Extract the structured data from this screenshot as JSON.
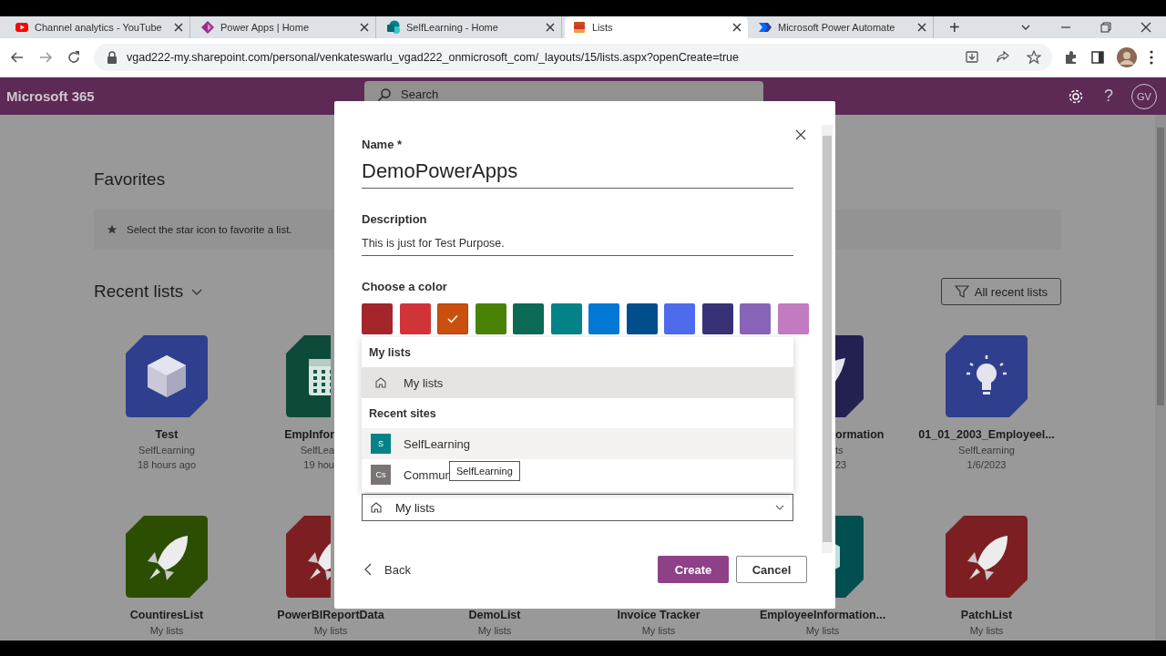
{
  "browser": {
    "tabs": [
      {
        "title": "Channel analytics - YouTube",
        "selected": false
      },
      {
        "title": "Power Apps | Home",
        "selected": false
      },
      {
        "title": "SelfLearning - Home",
        "selected": false
      },
      {
        "title": "Lists",
        "selected": true
      },
      {
        "title": "Microsoft Power Automate",
        "selected": false
      }
    ],
    "new_tab": "+",
    "address": "vgad222-my.sharepoint.com/personal/venkateswarlu_vgad222_onmicrosoft_com/_layouts/15/lists.aspx?openCreate=true"
  },
  "suite_bar": {
    "app_name": "Microsoft 365",
    "search": {
      "placeholder": "Search"
    },
    "help": "?",
    "avatar": "GV"
  },
  "page": {
    "favorites": {
      "title": "Favorites",
      "hint": "Select the star icon to favorite a list."
    },
    "recent": {
      "title": "Recent lists",
      "filter_button": "All recent lists"
    },
    "lists": [
      {
        "kind": "full",
        "title": "Test",
        "lines": [
          "SelfLearning",
          "18 hours ago"
        ],
        "color": "#2f3f8e"
      },
      {
        "kind": "partial-left",
        "title": "EmpInfor",
        "lines": [
          "SelfLea",
          "19 hou"
        ],
        "color": "#0d4a3a"
      },
      {
        "kind": "partial-right",
        "title": "ormation",
        "lines": [
          "ts",
          "23"
        ],
        "color": "#232052"
      },
      {
        "kind": "full",
        "title": "01_01_2003_Employeel...",
        "lines": [
          "SelfLearning",
          "1/6/2023"
        ],
        "color": "#2f3f8e"
      },
      {
        "kind": "full",
        "title": "CountiresList",
        "lines": [
          "My lists"
        ],
        "color": "#2c4e03"
      },
      {
        "kind": "icon-left",
        "title": "PowerBIReportData",
        "lines": [
          "My lists"
        ],
        "color": "#7d1f22"
      },
      {
        "kind": "title-only",
        "title": "DemoList",
        "lines": [
          "My lists"
        ]
      },
      {
        "kind": "title-only",
        "title": "Invoice Tracker",
        "lines": [
          "My lists"
        ]
      },
      {
        "kind": "icon-right",
        "title": "EmployeeInformation...",
        "lines": [
          "My lists"
        ],
        "color": "#024f51"
      },
      {
        "kind": "full",
        "title": "PatchList",
        "lines": [
          "My lists"
        ],
        "color": "#7d1f22"
      }
    ]
  },
  "dialog": {
    "name": {
      "label": "Name *",
      "value": "DemoPowerApps"
    },
    "description": {
      "label": "Description",
      "value": "This is just for Test Purpose."
    },
    "color_label": "Choose a color",
    "colors": [
      {
        "color": "#a4262c",
        "selected": false
      },
      {
        "color": "#d13438",
        "selected": false
      },
      {
        "color": "#ca5010",
        "selected": true
      },
      {
        "color": "#498205",
        "selected": false
      },
      {
        "color": "#0b6a53",
        "selected": false
      },
      {
        "color": "#038387",
        "selected": false
      },
      {
        "color": "#0078d4",
        "selected": false
      },
      {
        "color": "#004e8c",
        "selected": false
      },
      {
        "color": "#4f6bed",
        "selected": false
      },
      {
        "color": "#373277",
        "selected": false
      },
      {
        "color": "#8764b8",
        "selected": false
      },
      {
        "color": "#c27ac0",
        "selected": false
      }
    ],
    "location_menu": {
      "groups": [
        {
          "header": "My lists",
          "items": [
            {
              "kind": "home",
              "label": "My lists",
              "selected": true
            }
          ]
        },
        {
          "header": "Recent sites",
          "items": [
            {
              "kind": "site",
              "badge": "S",
              "color": "#038387",
              "label": "SelfLearning",
              "selected": false,
              "hovered": true
            },
            {
              "kind": "site",
              "badge": "Cs",
              "color": "#7a7574",
              "label": "Commun",
              "selected": false,
              "hovered": false
            }
          ]
        }
      ],
      "tooltip": "SelfLearning"
    },
    "location_field": {
      "value": "My lists"
    },
    "back": "Back",
    "create": "Create",
    "cancel": "Cancel"
  }
}
